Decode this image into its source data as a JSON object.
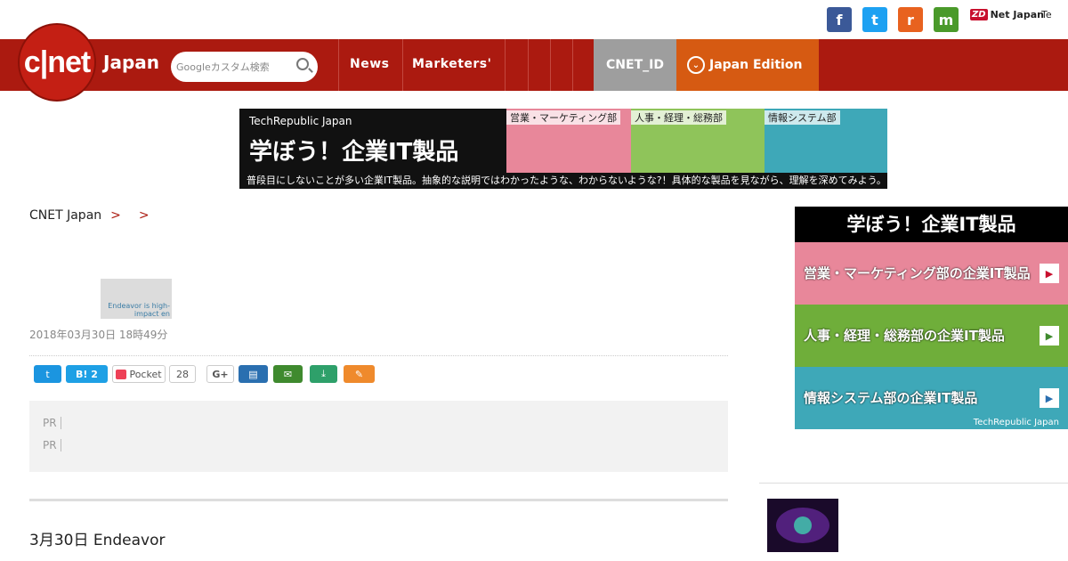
{
  "social": {
    "facebook": "f",
    "twitter": "t",
    "rss": "r",
    "mail": "m",
    "zdnet_mark": "ZD",
    "zdnet_label": "Net Japan",
    "techrepublic_label": "Te"
  },
  "nav": {
    "logo_text": "c|net",
    "logo_sub": "Japan",
    "search_placeholder": "Googleカスタム検索",
    "news": "News",
    "marketers": "Marketers'",
    "cnet_id": "CNET_ID",
    "edition": "Japan Edition"
  },
  "banner": {
    "sub": "TechRepublic Japan",
    "main": "学ぼう！企業IT製品",
    "panel1": "営業・マーケティング部",
    "panel2": "人事・経理・総務部",
    "panel3": "情報システム部",
    "foot": "普段目にしないことが多い企業IT製品。抽象的な説明ではわかったような、わからないような?！具体的な製品を見ながら、理解を深めてみよう。"
  },
  "breadcrumb": {
    "home": "CNET Japan",
    "sep": ">",
    "level1": "",
    "level2": ""
  },
  "article": {
    "title": "",
    "thumb_caption": "Endeavor is high-impact en",
    "byline": "2018年03月30日 18時49分",
    "hatena_label": "B!",
    "hatena_count": "2",
    "pocket_label": "Pocket",
    "pocket_count": "28",
    "gplus_label": "G+",
    "pr_tag": "PR",
    "pr1": "",
    "pr2": "",
    "body1": "3月30日 Endeavor",
    "body2": ""
  },
  "sidebar": {
    "ad_head": "学ぼう！企業IT製品",
    "row1": "営業・マーケティング部の企業IT製品",
    "row2": "人事・経理・総務部の企業IT製品",
    "row3": "情報システム部の企業IT製品",
    "ad_foot": "TechRepublic Japan",
    "feature_label": "",
    "feature_title": "",
    "feature_sub1": "",
    "feature_sub2": ""
  }
}
